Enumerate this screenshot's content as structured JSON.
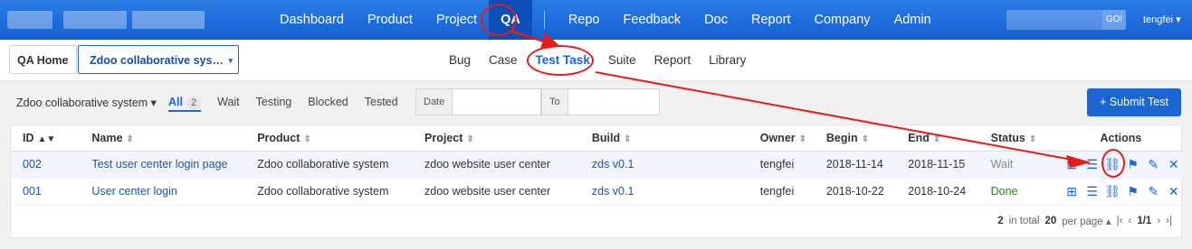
{
  "topbar": {
    "nav": [
      "Dashboard",
      "Product",
      "Project",
      "QA",
      "Repo",
      "Feedback",
      "Doc",
      "Report",
      "Company",
      "Admin"
    ],
    "active_nav": "QA",
    "go_label": "GO!",
    "user": "tengfei ▾"
  },
  "breadcrumb": {
    "home": "QA Home",
    "product": "Zdoo collaborative sys…",
    "caret": "▾"
  },
  "subnav": {
    "items": [
      "Bug",
      "Case",
      "Test Task",
      "Suite",
      "Report",
      "Library"
    ],
    "active": "Test Task"
  },
  "filters": {
    "product_select": "Zdoo collaborative system ▾",
    "tabs": [
      {
        "label": "All",
        "count": "2"
      },
      {
        "label": "Wait"
      },
      {
        "label": "Testing"
      },
      {
        "label": "Blocked"
      },
      {
        "label": "Tested"
      }
    ],
    "date_label": "Date",
    "to_label": "To",
    "submit_label": "+ Submit Test"
  },
  "table": {
    "columns": [
      "ID",
      "Name",
      "Product",
      "Project",
      "Build",
      "Owner",
      "Begin",
      "End",
      "Status",
      "Actions"
    ],
    "rows": [
      {
        "id": "002",
        "name": "Test user center login page",
        "product": "Zdoo collaborative system",
        "project": "zdoo website user center",
        "build": "zds v0.1",
        "owner": "tengfei",
        "begin": "2018-11-14",
        "end": "2018-11-15",
        "status": "Wait"
      },
      {
        "id": "001",
        "name": "User center login",
        "product": "Zdoo collaborative system",
        "project": "zdoo website user center",
        "build": "zds v0.1",
        "owner": "tengfei",
        "begin": "2018-10-22",
        "end": "2018-10-24",
        "status": "Done"
      }
    ],
    "action_icons": [
      "cases-icon",
      "list-icon",
      "link-icon",
      "flag-icon",
      "edit-icon",
      "delete-icon"
    ]
  },
  "pager": {
    "total": "2",
    "total_suffix": "in total",
    "per_page": "20",
    "per_page_suffix": "per page ▴",
    "page": "1/1"
  },
  "colors": {
    "topbar": "#1a66d2",
    "accent": "#1a66d2",
    "annotation": "#e41c1c"
  }
}
